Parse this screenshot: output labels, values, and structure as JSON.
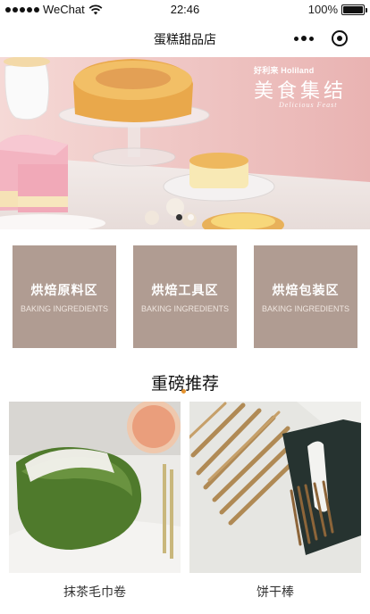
{
  "status_bar": {
    "carrier": "WeChat",
    "time": "22:46",
    "battery": "100%"
  },
  "nav": {
    "title": "蛋糕甜品店"
  },
  "banner": {
    "brand": "好利来 Holiland",
    "headline": "美食集结",
    "subline": "Delicious Feast",
    "slide_count": 2,
    "active_slide": 0
  },
  "categories": [
    {
      "title": "烘焙原料区",
      "subtitle": "BAKING INGREDIENTS"
    },
    {
      "title": "烘焙工具区",
      "subtitle": "BAKING INGREDIENTS"
    },
    {
      "title": "烘焙包装区",
      "subtitle": "BAKING INGREDIENTS"
    }
  ],
  "recommend": {
    "title": "重磅推荐",
    "products": [
      {
        "name": "抹茶毛巾卷"
      },
      {
        "name": "饼干棒"
      }
    ]
  },
  "colors": {
    "tile": "#b09c92",
    "accent": "#e5932f",
    "banner_bg": "#f1c8c6"
  }
}
